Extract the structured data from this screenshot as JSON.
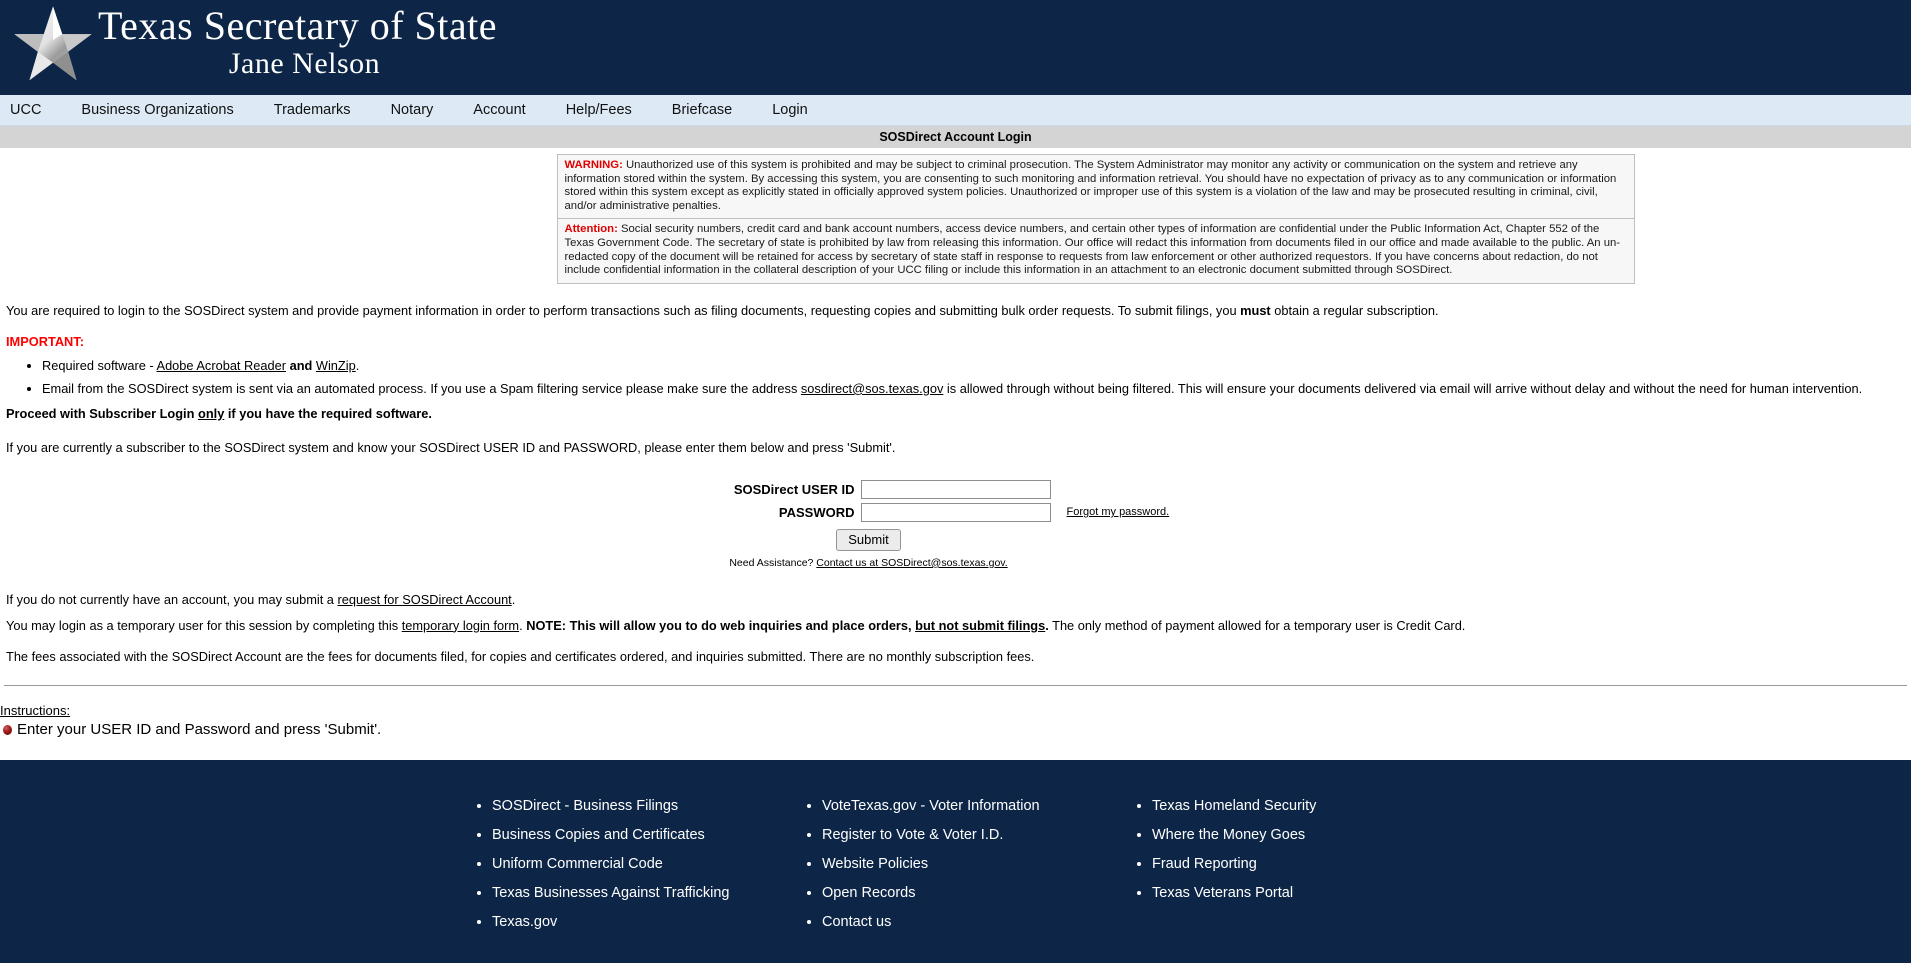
{
  "header": {
    "title_line1": "Texas Secretary of State",
    "title_line2": "Jane Nelson",
    "logo_name": "texas-star-logo"
  },
  "nav": {
    "items": [
      {
        "label": "UCC"
      },
      {
        "label": "Business Organizations"
      },
      {
        "label": "Trademarks"
      },
      {
        "label": "Notary"
      },
      {
        "label": "Account"
      },
      {
        "label": "Help/Fees"
      },
      {
        "label": "Briefcase"
      },
      {
        "label": "Login"
      }
    ]
  },
  "page": {
    "title": "SOSDirect Account Login"
  },
  "notices": {
    "warning": {
      "label": "WARNING:",
      "text": "Unauthorized use of this system is prohibited and may be subject to criminal prosecution. The System Administrator may monitor any activity or communication on the system and retrieve any information stored within the system. By accessing this system, you are consenting to such monitoring and information retrieval. You should have no expectation of privacy as to any communication or information stored within this system except as explicitly stated in officially approved system policies. Unauthorized or improper use of this system is a violation of the law and may be prosecuted resulting in criminal, civil, and/or administrative penalties."
    },
    "attention": {
      "label": "Attention:",
      "text": "Social security numbers, credit card and bank account numbers, access device numbers, and certain other types of information are confidential under the Public Information Act, Chapter 552 of the Texas Government Code. The secretary of state is prohibited by law from releasing this information. Our office will redact this information from documents filed in our office and made available to the public. An un-redacted copy of the document will be retained for access by secretary of state staff in response to requests from law enforcement or other authorized requestors. If you have concerns about redaction, do not include confidential information in the collateral description of your UCC filing or include this information in an attachment to an electronic document submitted through SOSDirect."
    }
  },
  "body": {
    "intro_part1": "You are required to login to the SOSDirect system and provide payment information in order to perform transactions such as filing documents, requesting copies and submitting bulk order requests. To submit filings, you ",
    "intro_must": "must",
    "intro_part2": " obtain a regular subscription.",
    "important_label": "IMPORTANT:",
    "bullet1_prefix": "Required software - ",
    "bullet1_link1": "Adobe Acrobat Reader",
    "bullet1_and": " and ",
    "bullet1_link2": "WinZip",
    "bullet1_suffix": ".",
    "bullet2_prefix": "Email from the SOSDirect system is sent via an automated process. If you use a Spam filtering service please make sure the address ",
    "bullet2_email": "sosdirect@sos.texas.gov",
    "bullet2_suffix": " is allowed through without being filtered. This will ensure your documents delivered via email will arrive without delay and without the need for human intervention.",
    "proceed_part1": "Proceed with Subscriber Login ",
    "proceed_only": "only",
    "proceed_part2": " if you have the required software.",
    "subscriber_line": "If you are currently a subscriber to the SOSDirect system and know your SOSDirect USER ID and PASSWORD, please enter them below and press 'Submit'.",
    "noaccount_prefix": "If you do not currently have an account, you may submit a ",
    "noaccount_link": "request for SOSDirect Account",
    "noaccount_suffix": ".",
    "temp_prefix": "You may login as a temporary user for this session by completing this ",
    "temp_link": "temporary login form",
    "temp_mid": ". ",
    "temp_note_bold": "NOTE: This will allow you to do web inquiries and place orders, ",
    "temp_note_underline": "but not submit filings",
    "temp_note_bold2": ".",
    "temp_suffix": " The only method of payment allowed for a temporary user is Credit Card.",
    "fees_line": "The fees associated with the SOSDirect Account are the fees for documents filed, for copies and certificates ordered, and inquiries submitted. There are no monthly subscription fees."
  },
  "form": {
    "userid_label": "SOSDirect USER ID",
    "userid_value": "",
    "password_label": "PASSWORD",
    "password_value": "",
    "forgot_link": "Forgot my password.",
    "submit_label": "Submit",
    "assist_prefix": "Need Assistance? ",
    "assist_link": "Contact us at SOSDirect@sos.texas.gov."
  },
  "instructions": {
    "title": "Instructions:",
    "items": [
      {
        "text": "Enter your USER ID and Password and press 'Submit'."
      }
    ]
  },
  "footer": {
    "columns": [
      {
        "items": [
          {
            "label": "SOSDirect - Business Filings"
          },
          {
            "label": "Business Copies and Certificates"
          },
          {
            "label": "Uniform Commercial Code"
          },
          {
            "label": "Texas Businesses Against Trafficking"
          },
          {
            "label": "Texas.gov"
          }
        ]
      },
      {
        "items": [
          {
            "label": "VoteTexas.gov - Voter Information"
          },
          {
            "label": "Register to Vote & Voter I.D."
          },
          {
            "label": "Website Policies"
          },
          {
            "label": "Open Records"
          },
          {
            "label": "Contact us"
          }
        ]
      },
      {
        "items": [
          {
            "label": "Texas Homeland Security"
          },
          {
            "label": "Where the Money Goes"
          },
          {
            "label": "Fraud Reporting"
          },
          {
            "label": "Texas Veterans Portal"
          }
        ]
      }
    ]
  },
  "colors": {
    "navy": "#0d2546",
    "nav_bg": "#ddeaf6",
    "title_bar": "#d4d4d4",
    "alert_red": "#e00000"
  }
}
